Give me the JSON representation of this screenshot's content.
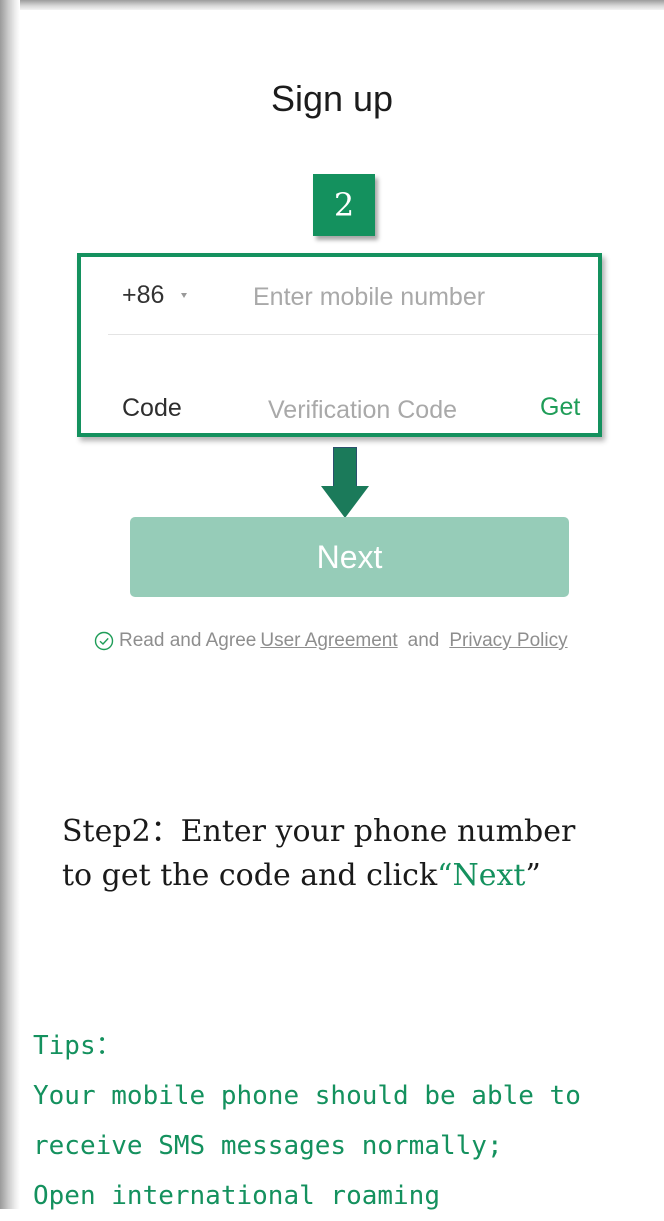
{
  "header": {
    "title": "Sign up"
  },
  "step_badge": {
    "number": "2"
  },
  "form": {
    "country_code": "+86",
    "phone_placeholder": "Enter mobile number",
    "code_label": "Code",
    "code_placeholder": "Verification Code",
    "get_button_label": "Get"
  },
  "next_button": {
    "label": "Next"
  },
  "agreement": {
    "prefix": "Read and Agree",
    "user_agreement_link": "User Agreement",
    "conjunction": "and",
    "privacy_policy_link": "Privacy Policy"
  },
  "instruction": {
    "line1": "Step2：Enter your phone number",
    "line2_prefix": "to get the code and click",
    "open_quote": "“",
    "highlight": "Next",
    "close_quote": "”"
  },
  "tips": {
    "heading": "Tips：",
    "lines": [
      "Your mobile phone should be able to",
      "receive SMS messages normally;",
      "Open international roaming"
    ]
  },
  "colors": {
    "accent_green": "#14915e",
    "next_button_bg": "#96ccb8",
    "get_link": "#1f9d58",
    "arrow": "#1b7a5a"
  },
  "icons": {
    "dropdown": "caret-down-icon",
    "agreement_check": "check-circle-icon",
    "step_arrow": "arrow-down-icon"
  }
}
